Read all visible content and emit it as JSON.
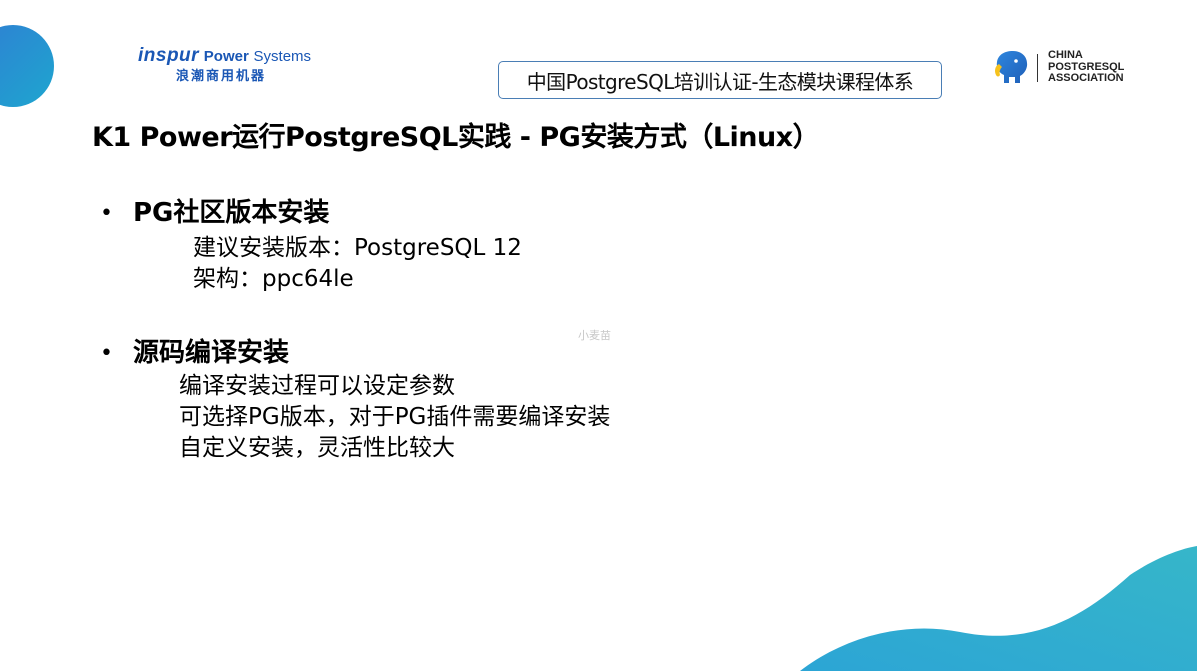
{
  "header": {
    "inspur_brand": "inspur",
    "inspur_power": "Power",
    "inspur_systems": "Systems",
    "inspur_chinese": "浪潮商用机器",
    "course_title": "中国PostgreSQL培训认证-生态模块课程体系",
    "association_lines": [
      "CHINA",
      "POSTGRESQL",
      "ASSOCIATION"
    ]
  },
  "slide": {
    "title": "K1 Power运行PostgreSQL实践 - PG安装方式（Linux）",
    "sections": [
      {
        "bullet": "•",
        "heading": "PG社区版本安装",
        "lines": [
          "建议安装版本：PostgreSQL 12",
          "架构：ppc64le"
        ]
      },
      {
        "bullet": "•",
        "heading": "源码编译安装",
        "lines": [
          "编译安装过程可以设定参数",
          "可选择PG版本，对于PG插件需要编译安装",
          "自定义安装，灵活性比较大"
        ]
      }
    ],
    "watermark": "小麦苗"
  },
  "colors": {
    "brand_blue": "#1a57b5",
    "accent_teal": "#1ea6cf",
    "box_border": "#4a7eb5"
  },
  "icons": [
    "elephant-logo-icon"
  ]
}
